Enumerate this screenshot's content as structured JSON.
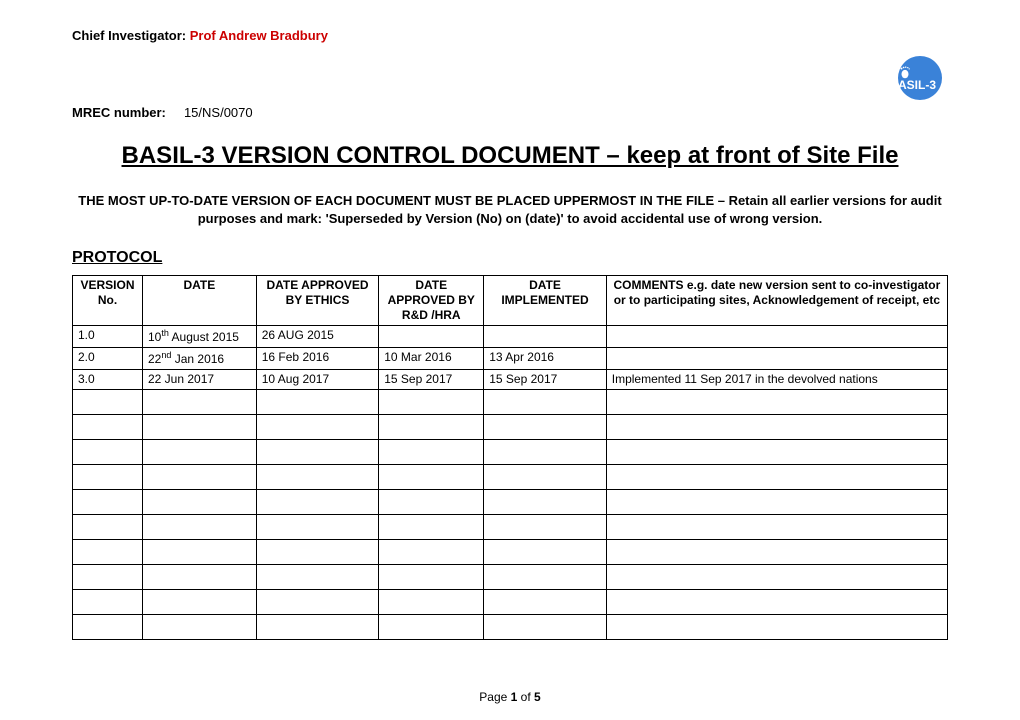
{
  "header": {
    "chief_label": "Chief Investigator: ",
    "chief_name": "Prof Andrew Bradbury",
    "logo_text": "ASIL-3",
    "mrec_label": "MREC number:",
    "mrec_value": "15/NS/0070"
  },
  "title": "BASIL-3 VERSION CONTROL DOCUMENT – keep at front of Site File",
  "instructions": "THE MOST UP-TO-DATE VERSION OF EACH DOCUMENT MUST BE PLACED UPPERMOST IN THE FILE – Retain all earlier versions for audit purposes and mark: 'Superseded by Version (No) on (date)' to avoid accidental use of wrong version.",
  "section": "PROTOCOL",
  "table": {
    "headers": {
      "version": "VERSION No.",
      "date": "DATE",
      "ethics": "DATE APPROVED BY ETHICS",
      "rnd": "DATE APPROVED BY R&D /HRA",
      "impl": "DATE IMPLEMENTED",
      "comments": "COMMENTS e.g. date new version sent to co-investigator or to participating sites, Acknowledgement of receipt, etc"
    },
    "rows": [
      {
        "version": "1.0",
        "date_html": "10<sup>th</sup> August 2015",
        "ethics": "26 AUG 2015",
        "rnd": "",
        "impl": "",
        "comments": ""
      },
      {
        "version": "2.0",
        "date_html": "22<sup>nd</sup> Jan 2016",
        "ethics": "16 Feb 2016",
        "rnd": "10 Mar 2016",
        "impl": "13 Apr 2016",
        "comments": ""
      },
      {
        "version": "3.0",
        "date_html": "22 Jun 2017",
        "ethics": "10 Aug 2017",
        "rnd": "15 Sep 2017",
        "impl": "15 Sep 2017",
        "comments": "Implemented 11 Sep 2017 in the devolved nations"
      }
    ],
    "blank_rows": 10
  },
  "pager": {
    "page_word": "Page ",
    "current": "1",
    "of_word": " of ",
    "total": "5"
  }
}
